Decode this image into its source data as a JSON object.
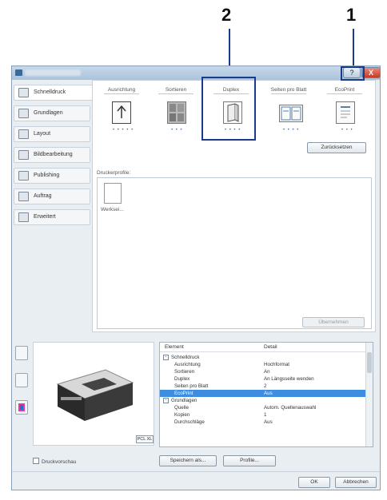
{
  "callouts": {
    "one": "1",
    "two": "2"
  },
  "window": {
    "help_label": "?",
    "close_label": "X"
  },
  "nav": {
    "items": [
      {
        "label": "Schnelldruck"
      },
      {
        "label": "Grundlagen"
      },
      {
        "label": "Layout"
      },
      {
        "label": "Bildbearbeitung"
      },
      {
        "label": "Publishing"
      },
      {
        "label": "Auftrag"
      },
      {
        "label": "Erweitert"
      }
    ]
  },
  "tabs": [
    {
      "label": "Ausrichtung",
      "dots": "• • • • •"
    },
    {
      "label": "Sortieren",
      "dots": "• • •"
    },
    {
      "label": "Duplex",
      "dots": "• • • •"
    },
    {
      "label": "Seiten pro Blatt",
      "dots": "• • • •"
    },
    {
      "label": "EcoPrint",
      "dots": "• • •"
    }
  ],
  "reset_label": "Zurücksetzen",
  "profiles": {
    "label": "Druckerprofile:",
    "item_name": "Werksei...",
    "apply_label": "Übernehmen"
  },
  "preview": {
    "badge": "PCL XL"
  },
  "details": {
    "header_element": "Element",
    "header_detail": "Detail",
    "rows": [
      {
        "element": "Schnelldruck",
        "detail": "",
        "group": true
      },
      {
        "element": "Ausrichtung",
        "detail": "Hochformat"
      },
      {
        "element": "Sortieren",
        "detail": "An"
      },
      {
        "element": "Duplex",
        "detail": "An Längsseite wenden"
      },
      {
        "element": "Seiten pro Blatt",
        "detail": "2"
      },
      {
        "element": "EcoPrint",
        "detail": "Aus",
        "selected": true
      },
      {
        "element": "Grundlagen",
        "detail": "",
        "group": true
      },
      {
        "element": "Quelle",
        "detail": "Autom. Quellenauswahl"
      },
      {
        "element": "Kopien",
        "detail": "1"
      },
      {
        "element": "Durchschläge",
        "detail": "Aus"
      }
    ]
  },
  "footer": {
    "checkbox_label": "Druckvorschau",
    "save_label": "Speichern als...",
    "profile_label": "Profile...",
    "ok_label": "OK",
    "cancel_label": "Abbrechen"
  }
}
